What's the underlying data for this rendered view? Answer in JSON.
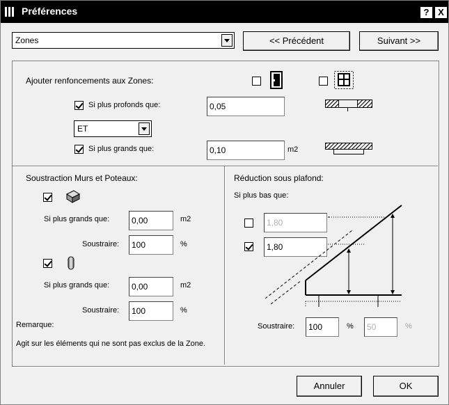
{
  "window": {
    "title": "Préférences",
    "help_label": "?",
    "close_label": "X"
  },
  "nav": {
    "category": "Zones",
    "prev_label": "<< Précédent",
    "next_label": "Suivant >>"
  },
  "niches": {
    "heading": "Ajouter renfoncements aux Zones:",
    "door_checked": false,
    "window_checked": false,
    "deeper": {
      "label": "Si plus profonds que:",
      "checked": true,
      "value": "0,05"
    },
    "operator": "ET",
    "larger": {
      "label": "Si plus grands que:",
      "checked": true,
      "value": "0,10",
      "unit": "m2"
    }
  },
  "subtraction": {
    "heading": "Soustraction Murs et Poteaux:",
    "walls": {
      "checked": true,
      "icon": "wall-icon",
      "larger_label": "Si plus grands que:",
      "larger_value": "0,00",
      "larger_unit": "m2",
      "subtract_label": "Soustraire:",
      "subtract_value": "100",
      "subtract_unit": "%"
    },
    "columns": {
      "checked": true,
      "icon": "column-icon",
      "larger_label": "Si plus grands que:",
      "larger_value": "0,00",
      "larger_unit": "m2",
      "subtract_label": "Soustraire:",
      "subtract_value": "100",
      "subtract_unit": "%"
    },
    "note_title": "Remarque:",
    "note_text": "Agit sur les éléments qui ne sont pas exclus de la Zone."
  },
  "ceiling": {
    "heading": "Réduction sous plafond:",
    "lower_label": "Si plus bas que:",
    "level1": {
      "checked": false,
      "value": "1,80"
    },
    "level2": {
      "checked": true,
      "value": "1,80"
    },
    "subtract_label": "Soustraire:",
    "subtract1_value": "100",
    "subtract1_unit": "%",
    "subtract2_value": "50",
    "subtract2_unit": "%"
  },
  "footer": {
    "cancel_label": "Annuler",
    "ok_label": "OK"
  }
}
